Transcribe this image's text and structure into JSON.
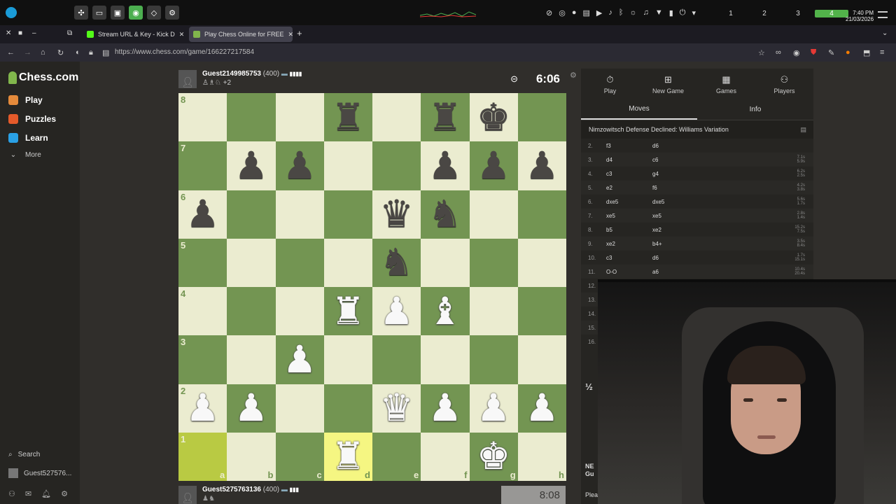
{
  "taskbar": {
    "workspaces": [
      "1",
      "2",
      "3",
      "4"
    ],
    "active_workspace": "4",
    "clock_time": "7:40 PM",
    "clock_date": "21/03/2026"
  },
  "browser": {
    "tabs": [
      {
        "title": "Stream URL & Key - Kick D",
        "active": false
      },
      {
        "title": "Play Chess Online for FREE",
        "active": true
      }
    ],
    "url": "https://www.chess.com/game/166227217584"
  },
  "sidebar": {
    "logo": "Chess.com",
    "items": [
      {
        "label": "Play",
        "color": "#e58a3b"
      },
      {
        "label": "Puzzles",
        "color": "#e55a2a"
      },
      {
        "label": "Learn",
        "color": "#2aa0e5"
      },
      {
        "label": "More",
        "color": "#888888"
      }
    ],
    "search_label": "Search",
    "user_label": "Guest527576..."
  },
  "top_player": {
    "name": "Guest2149985753",
    "rating": "(400)",
    "material": "+2",
    "clock": "6:06"
  },
  "bottom_player": {
    "name": "Guest5275763136",
    "rating": "(400)",
    "clock": "8:08"
  },
  "board": {
    "files": [
      "a",
      "b",
      "c",
      "d",
      "e",
      "f",
      "g",
      "h"
    ],
    "ranks": [
      "8",
      "7",
      "6",
      "5",
      "4",
      "3",
      "2",
      "1"
    ],
    "position": [
      [
        "",
        "",
        "",
        "bR",
        "",
        "bR",
        "bK",
        ""
      ],
      [
        "",
        "bP",
        "bP",
        "",
        "",
        "bP",
        "bP",
        "bP"
      ],
      [
        "bP",
        "",
        "",
        "",
        "bQ",
        "bN",
        "",
        ""
      ],
      [
        "",
        "",
        "",
        "",
        "bN",
        "",
        "",
        ""
      ],
      [
        "",
        "",
        "",
        "wR",
        "wP",
        "wB",
        "",
        ""
      ],
      [
        "",
        "",
        "wP",
        "",
        "",
        "",
        "",
        ""
      ],
      [
        "wP",
        "wP",
        "",
        "",
        "wQ",
        "wP",
        "wP",
        "wP"
      ],
      [
        "",
        "",
        "",
        "wR",
        "",
        "",
        "wK",
        ""
      ]
    ],
    "highlight": [
      "a1",
      "d1"
    ]
  },
  "panel": {
    "tabs": [
      {
        "label": "Play",
        "icon": "stopwatch-icon"
      },
      {
        "label": "New Game",
        "icon": "plus-square-icon"
      },
      {
        "label": "Games",
        "icon": "grid-icon"
      },
      {
        "label": "Players",
        "icon": "players-icon"
      }
    ],
    "subtabs": [
      "Moves",
      "Info"
    ],
    "opening": "Nimzowitsch Defense Declined: Williams Variation",
    "moves": [
      {
        "n": "2.",
        "w": "f3",
        "b": "d6",
        "wt": "",
        "bt": ""
      },
      {
        "n": "3.",
        "w": "d4",
        "b": "c6",
        "wt": "7.1s",
        "bt": "5.9s"
      },
      {
        "n": "4.",
        "w": "c3",
        "b": "g4",
        "wt": "6.2s",
        "bt": "2.5s"
      },
      {
        "n": "5.",
        "w": "e2",
        "b": "f6",
        "wt": "4.2s",
        "bt": "3.8s"
      },
      {
        "n": "6.",
        "w": "dxe5",
        "b": "dxe5",
        "wt": "5.6s",
        "bt": "1.7s"
      },
      {
        "n": "7.",
        "w": "xe5",
        "b": "xe5",
        "wt": "2.8s",
        "bt": "1.4s"
      },
      {
        "n": "8.",
        "w": "b5",
        "b": "xe2",
        "wt": "15.2s",
        "bt": "7.5s"
      },
      {
        "n": "9.",
        "w": "xe2",
        "b": "b4+",
        "wt": "3.5s",
        "bt": "8.4s"
      },
      {
        "n": "10.",
        "w": "c3",
        "b": "d6",
        "wt": "1.7s",
        "bt": "15.1s"
      },
      {
        "n": "11.",
        "w": "O-O",
        "b": "a6",
        "wt": "10.4s",
        "bt": "20.4s"
      }
    ],
    "partial_rows": [
      "12.",
      "13.",
      "14.",
      "15.",
      "16."
    ],
    "draw_label": "½",
    "foot_new": "NE",
    "foot_gu": "Gu",
    "foot_plea": "Plea"
  }
}
